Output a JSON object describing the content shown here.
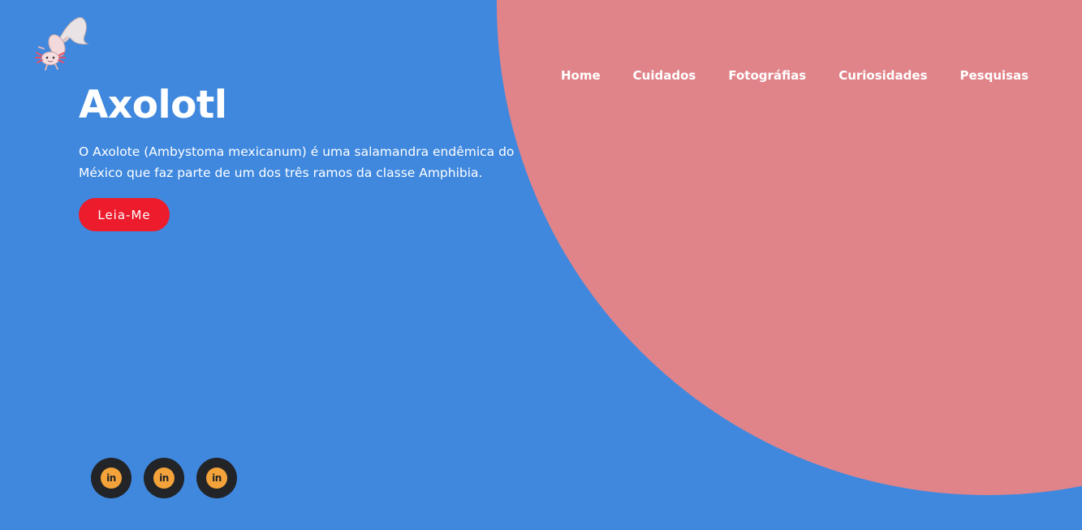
{
  "colors": {
    "background": "#3f88de",
    "blob": "#e0848a",
    "button": "#ec1c2c",
    "social_outer": "#222427",
    "social_inner": "#f4a33a",
    "social_glyph": "#222427"
  },
  "logo": {
    "icon": "axolotl-logo-icon"
  },
  "nav": {
    "items": [
      {
        "label": "Home"
      },
      {
        "label": "Cuidados"
      },
      {
        "label": "Fotográfias"
      },
      {
        "label": "Curiosidades"
      },
      {
        "label": "Pesquisas"
      }
    ]
  },
  "hero": {
    "title": "Axolotl",
    "description": "O Axolote (Ambystoma mexicanum) é uma salamandra endêmica do México que faz parte de um dos três ramos da classe Amphibia.",
    "button_label": "Leia-Me"
  },
  "socials": [
    {
      "icon": "linkedin-icon",
      "glyph": "in"
    },
    {
      "icon": "linkedin-icon",
      "glyph": "in"
    },
    {
      "icon": "linkedin-icon",
      "glyph": "in"
    }
  ]
}
